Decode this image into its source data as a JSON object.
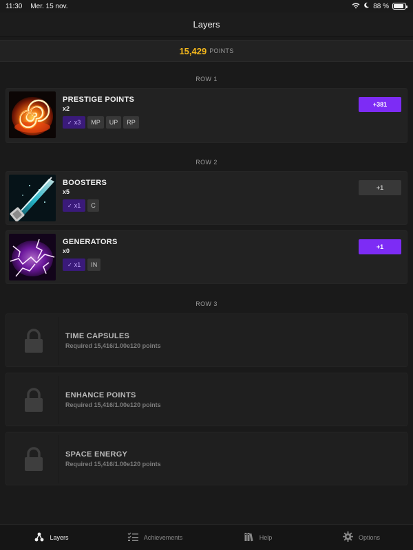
{
  "status_bar": {
    "time": "11:30",
    "date": "Mer. 15 nov.",
    "battery": "88 %",
    "battery_level": 0.88
  },
  "nav": {
    "title": "Layers"
  },
  "points": {
    "value": "15,429",
    "label": "POINTS"
  },
  "rows": [
    {
      "label": "ROW 1",
      "layers": [
        {
          "name": "PRESTIGE POINTS",
          "count": "x2",
          "multiplier": "x3",
          "tags": [
            "MP",
            "UP",
            "RP"
          ],
          "action": "+381",
          "action_active": true,
          "thumb": "spiral-fire"
        }
      ]
    },
    {
      "label": "ROW 2",
      "layers": [
        {
          "name": "BOOSTERS",
          "count": "x5",
          "multiplier": "x1",
          "tags": [
            "C"
          ],
          "action": "+1",
          "action_active": false,
          "thumb": "cyan-beam"
        },
        {
          "name": "GENERATORS",
          "count": "x0",
          "multiplier": "x1",
          "tags": [
            "IN"
          ],
          "action": "+1",
          "action_active": true,
          "thumb": "purple-lightning"
        }
      ]
    },
    {
      "label": "ROW 3",
      "locked": [
        {
          "name": "TIME CAPSULES",
          "requirement": "Required 15,416/1.00e120 points"
        },
        {
          "name": "ENHANCE POINTS",
          "requirement": "Required 15,416/1.00e120 points"
        },
        {
          "name": "SPACE ENERGY",
          "requirement": "Required 15,416/1.00e120 points"
        }
      ]
    }
  ],
  "tabs": [
    {
      "label": "Layers",
      "icon": "layers-icon",
      "active": true
    },
    {
      "label": "Achievements",
      "icon": "checklist-icon",
      "active": false
    },
    {
      "label": "Help",
      "icon": "books-icon",
      "active": false
    },
    {
      "label": "Options",
      "icon": "gear-icon",
      "active": false
    }
  ],
  "colors": {
    "accent": "#7d2cf5",
    "points": "#f5b81c",
    "background": "#1a1a1a"
  }
}
